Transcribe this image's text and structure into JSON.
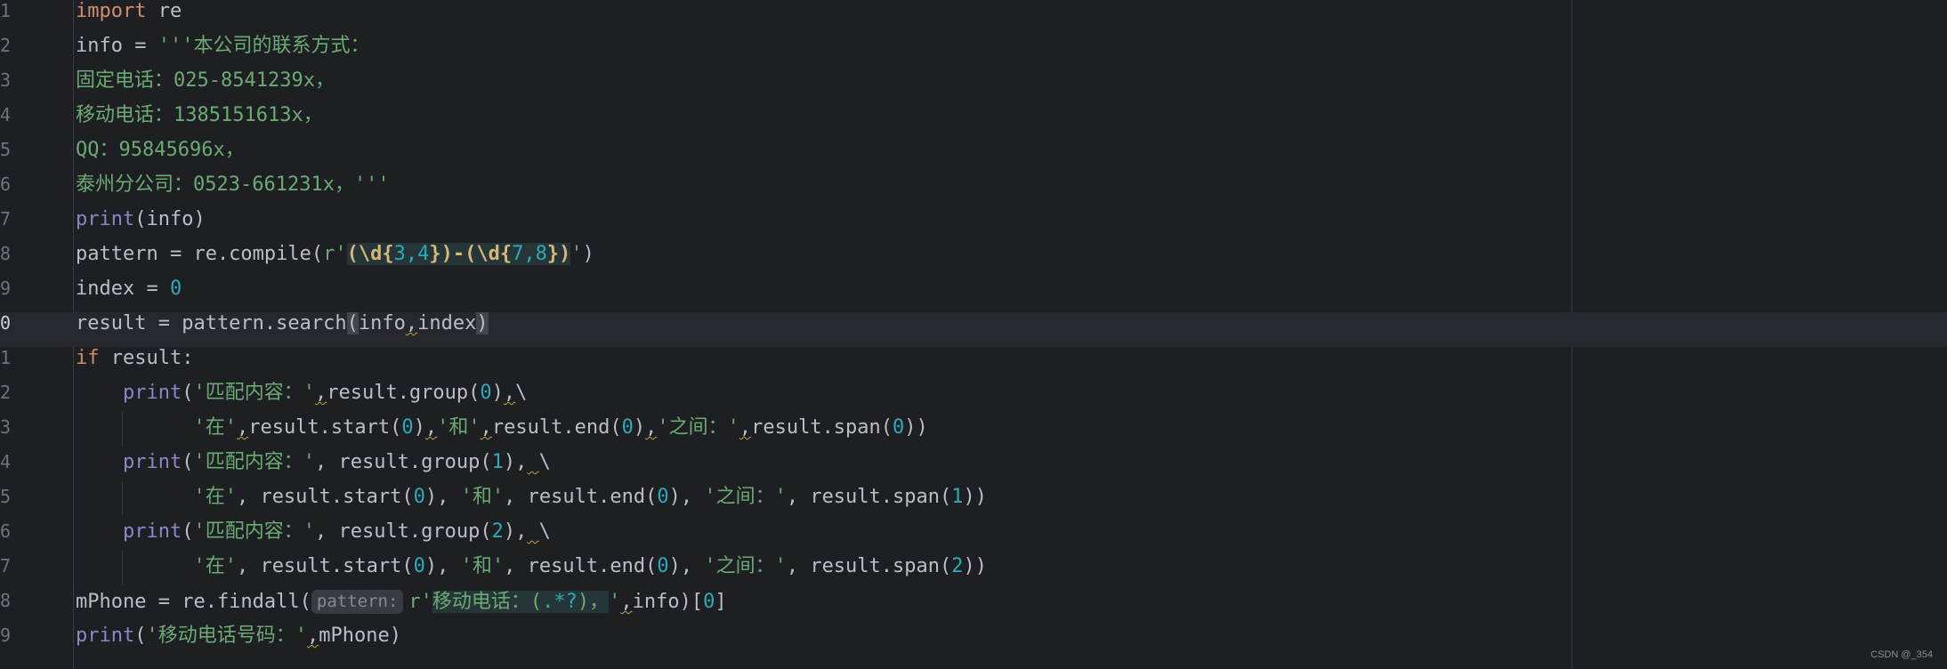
{
  "editor": {
    "current_line": "10",
    "watermark": "CSDN @_354",
    "lines": [
      {
        "n": "1",
        "t": [
          "import",
          " re"
        ]
      },
      {
        "n": "2",
        "t": [
          "info = ",
          "'''本公司的联系方式："
        ]
      },
      {
        "n": "3",
        "t": [
          "固定电话：025-8541239x，"
        ]
      },
      {
        "n": "4",
        "t": [
          "移动电话：1385151613x，"
        ]
      },
      {
        "n": "5",
        "t": [
          "QQ：95845696x，"
        ]
      },
      {
        "n": "6",
        "t": [
          "泰州分公司：0523-661231x，'''"
        ]
      },
      {
        "n": "7",
        "t": [
          "print",
          "(info)"
        ]
      },
      {
        "n": "8",
        "t": [
          "pattern = re.compile(",
          "r'",
          "(",
          "\\d",
          "{",
          "3",
          ",",
          "4",
          "})-(",
          "\\d",
          "{",
          "7",
          ",",
          "8",
          "})",
          "'",
          ")"
        ]
      },
      {
        "n": "9",
        "t": [
          "index = ",
          "0"
        ]
      },
      {
        "n": "0",
        "t": [
          "result = pattern.search",
          "(",
          "info",
          ",",
          "index",
          ")"
        ]
      },
      {
        "n": "1",
        "t": [
          "if",
          " result:"
        ]
      },
      {
        "n": "2",
        "t": [
          "    ",
          "print",
          "(",
          "'匹配内容：'",
          ",",
          "result.group(",
          "0",
          ")",
          ",",
          "\\"
        ]
      },
      {
        "n": "3",
        "t": [
          "          ",
          "'在'",
          ",",
          "result.start(",
          "0",
          ")",
          ",",
          "'和'",
          ",",
          "result.end(",
          "0",
          ")",
          ",",
          "'之间：'",
          ",",
          "result.span(",
          "0",
          "))"
        ]
      },
      {
        "n": "4",
        "t": [
          "    ",
          "print",
          "(",
          "'匹配内容：'",
          ", result.group(",
          "1",
          "),",
          " ",
          "\\"
        ]
      },
      {
        "n": "5",
        "t": [
          "          ",
          "'在'",
          ", result.start(",
          "0",
          "), ",
          "'和'",
          ", result.end(",
          "0",
          "), ",
          "'之间：'",
          ", result.span(",
          "1",
          "))"
        ]
      },
      {
        "n": "6",
        "t": [
          "    ",
          "print",
          "(",
          "'匹配内容：'",
          ", result.group(",
          "2",
          "),",
          " ",
          "\\"
        ]
      },
      {
        "n": "7",
        "t": [
          "          ",
          "'在'",
          ", result.start(",
          "0",
          "), ",
          "'和'",
          ", result.end(",
          "0",
          "), ",
          "'之间：'",
          ", result.span(",
          "2",
          "))"
        ]
      },
      {
        "n": "8",
        "t": [
          "mPhone = re.findall(",
          "pattern:",
          "r'",
          "移动电话：(",
          ".*?",
          ")，",
          "'",
          ",",
          "info)[",
          "0",
          "]"
        ]
      },
      {
        "n": "9",
        "t": [
          "print",
          "(",
          "'移动电话号码：'",
          ",",
          "mPhone)"
        ]
      }
    ]
  }
}
